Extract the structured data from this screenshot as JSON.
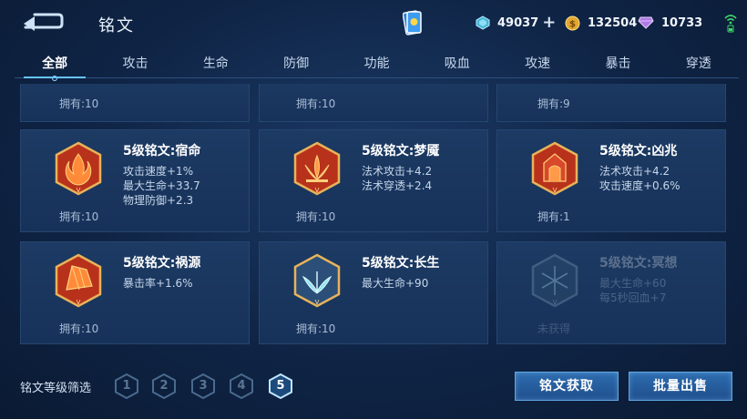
{
  "header": {
    "title": "铭文",
    "currencies": [
      {
        "icon": "crystal-icon",
        "value": "49037"
      },
      {
        "icon": "gold-coin-icon",
        "value": "132504"
      },
      {
        "icon": "diamond-icon",
        "value": "10733"
      }
    ],
    "add_label": "+"
  },
  "tabs": [
    {
      "label": "全部",
      "active": true
    },
    {
      "label": "攻击"
    },
    {
      "label": "生命"
    },
    {
      "label": "防御"
    },
    {
      "label": "功能"
    },
    {
      "label": "吸血"
    },
    {
      "label": "攻速"
    },
    {
      "label": "暴击"
    },
    {
      "label": "穿透"
    }
  ],
  "partial_row": [
    {
      "count": "拥有:10"
    },
    {
      "count": "拥有:10"
    },
    {
      "count": "拥有:9"
    }
  ],
  "runes": [
    {
      "name": "5级铭文:宿命",
      "stats": [
        "攻击速度+1%",
        "最大生命+33.7",
        "物理防御+2.3"
      ],
      "count": "拥有:10",
      "color": "#c5391c",
      "icon": "flame-rune-icon"
    },
    {
      "name": "5级铭文:梦魇",
      "stats": [
        "法术攻击+4.2",
        "法术穿透+2.4"
      ],
      "count": "拥有:10",
      "color": "#c5391c",
      "icon": "lotus-rune-icon"
    },
    {
      "name": "5级铭文:凶兆",
      "stats": [
        "法术攻击+4.2",
        "攻击速度+0.6%"
      ],
      "count": "拥有:1",
      "color": "#c5391c",
      "icon": "gate-rune-icon"
    },
    {
      "name": "5级铭文:祸源",
      "stats": [
        "暴击率+1.6%"
      ],
      "count": "拥有:10",
      "color": "#c5391c",
      "icon": "fan-rune-icon"
    },
    {
      "name": "5级铭文:长生",
      "stats": [
        "最大生命+90"
      ],
      "count": "拥有:10",
      "color": "#3d7fb0",
      "icon": "leaf-rune-icon"
    },
    {
      "name": "5级铭文:冥想",
      "stats": [
        "最大生命+60",
        "每5秒回血+7"
      ],
      "count": "未获得",
      "color": "#3a5a78",
      "icon": "snowflake-rune-icon",
      "locked": true
    }
  ],
  "footer": {
    "filter_label": "铭文等级筛选",
    "levels": [
      "1",
      "2",
      "3",
      "4",
      "5"
    ],
    "active_level": "5",
    "obtain_label": "铭文获取",
    "sell_label": "批量出售"
  }
}
